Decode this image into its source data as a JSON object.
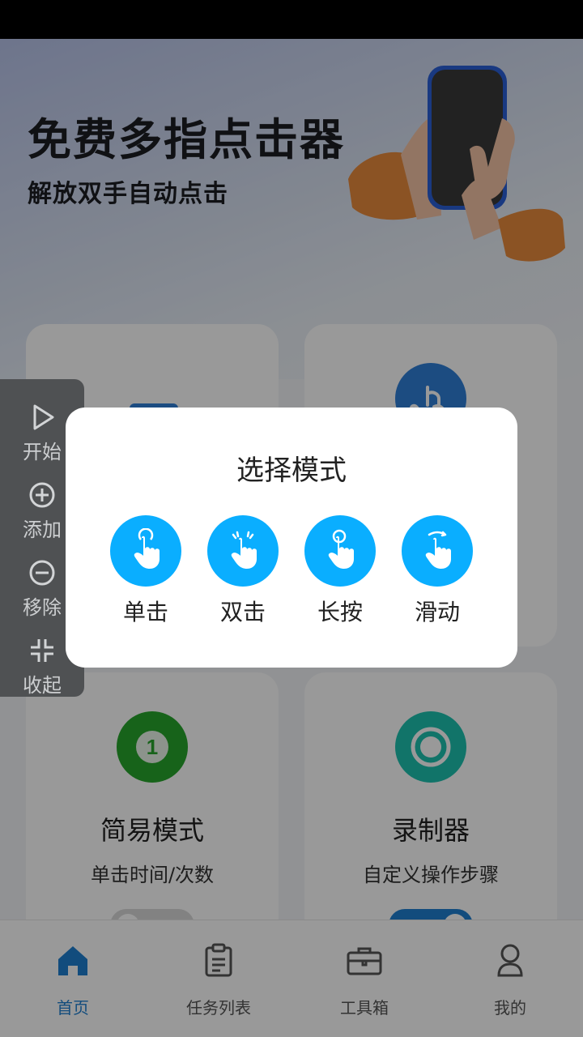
{
  "hero": {
    "title": "免费多指点击器",
    "subtitle": "解放双手自动点击"
  },
  "cards": [
    {
      "title": "",
      "desc": "",
      "icon": "tap-icon",
      "color": "#2f7fd8"
    },
    {
      "title": "",
      "desc": "",
      "icon": "touch-icon",
      "color": "#2f7fd8"
    },
    {
      "title": "简易模式",
      "desc": "单击时间/次数",
      "icon": "number-one-icon",
      "color": "#27a52c",
      "toggle_on": false
    },
    {
      "title": "录制器",
      "desc": "自定义操作步骤",
      "icon": "record-icon",
      "color": "#1dc1b0",
      "toggle_on": true
    }
  ],
  "side_panel": {
    "items": [
      {
        "label": "开始",
        "icon": "play-icon"
      },
      {
        "label": "添加",
        "icon": "plus-circle-icon"
      },
      {
        "label": "移除",
        "icon": "minus-circle-icon"
      },
      {
        "label": "收起",
        "icon": "collapse-icon"
      }
    ]
  },
  "dialog": {
    "title": "选择模式",
    "modes": [
      {
        "label": "单击",
        "icon": "single-tap-icon"
      },
      {
        "label": "双击",
        "icon": "double-tap-icon"
      },
      {
        "label": "长按",
        "icon": "long-press-icon"
      },
      {
        "label": "滑动",
        "icon": "swipe-icon"
      }
    ],
    "accent": "#0aaeff"
  },
  "bottom_nav": {
    "active_color": "#1e7fd0",
    "items": [
      {
        "label": "首页",
        "icon": "home-icon",
        "active": true
      },
      {
        "label": "任务列表",
        "icon": "clipboard-icon",
        "active": false
      },
      {
        "label": "工具箱",
        "icon": "toolbox-icon",
        "active": false
      },
      {
        "label": "我的",
        "icon": "profile-icon",
        "active": false
      }
    ]
  }
}
